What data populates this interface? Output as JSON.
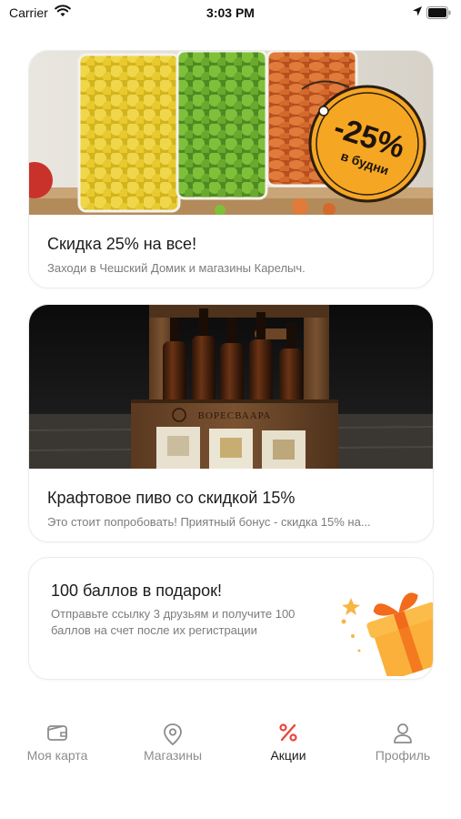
{
  "status_bar": {
    "carrier": "Carrier",
    "time": "3:03 PM"
  },
  "promos": [
    {
      "title": "Скидка 25% на все!",
      "subtitle": "Заходи в Чешский Домик и магазины Карелыч.",
      "badge_main": "-25%",
      "badge_sub": "в будни"
    },
    {
      "title": "Крафтовое пиво со скидкой 15%",
      "subtitle": "Это стоит попробовать! Приятный бонус - скидка 15% на...",
      "crate_text": "ВОРЕСВААРА"
    }
  ],
  "referral": {
    "title": "100 баллов в подарок!",
    "description": "Отправьте ссылку 3 друзьям и получите 100 баллов на счет после их регистрации"
  },
  "tabs": [
    {
      "label": "Моя карта",
      "icon": "wallet-icon"
    },
    {
      "label": "Магазины",
      "icon": "map-pin-icon"
    },
    {
      "label": "Акции",
      "icon": "percent-icon"
    },
    {
      "label": "Профиль",
      "icon": "user-icon"
    }
  ],
  "colors": {
    "accent": "#e8473b",
    "badge": "#f5a623",
    "gift": "#fbb03b"
  }
}
